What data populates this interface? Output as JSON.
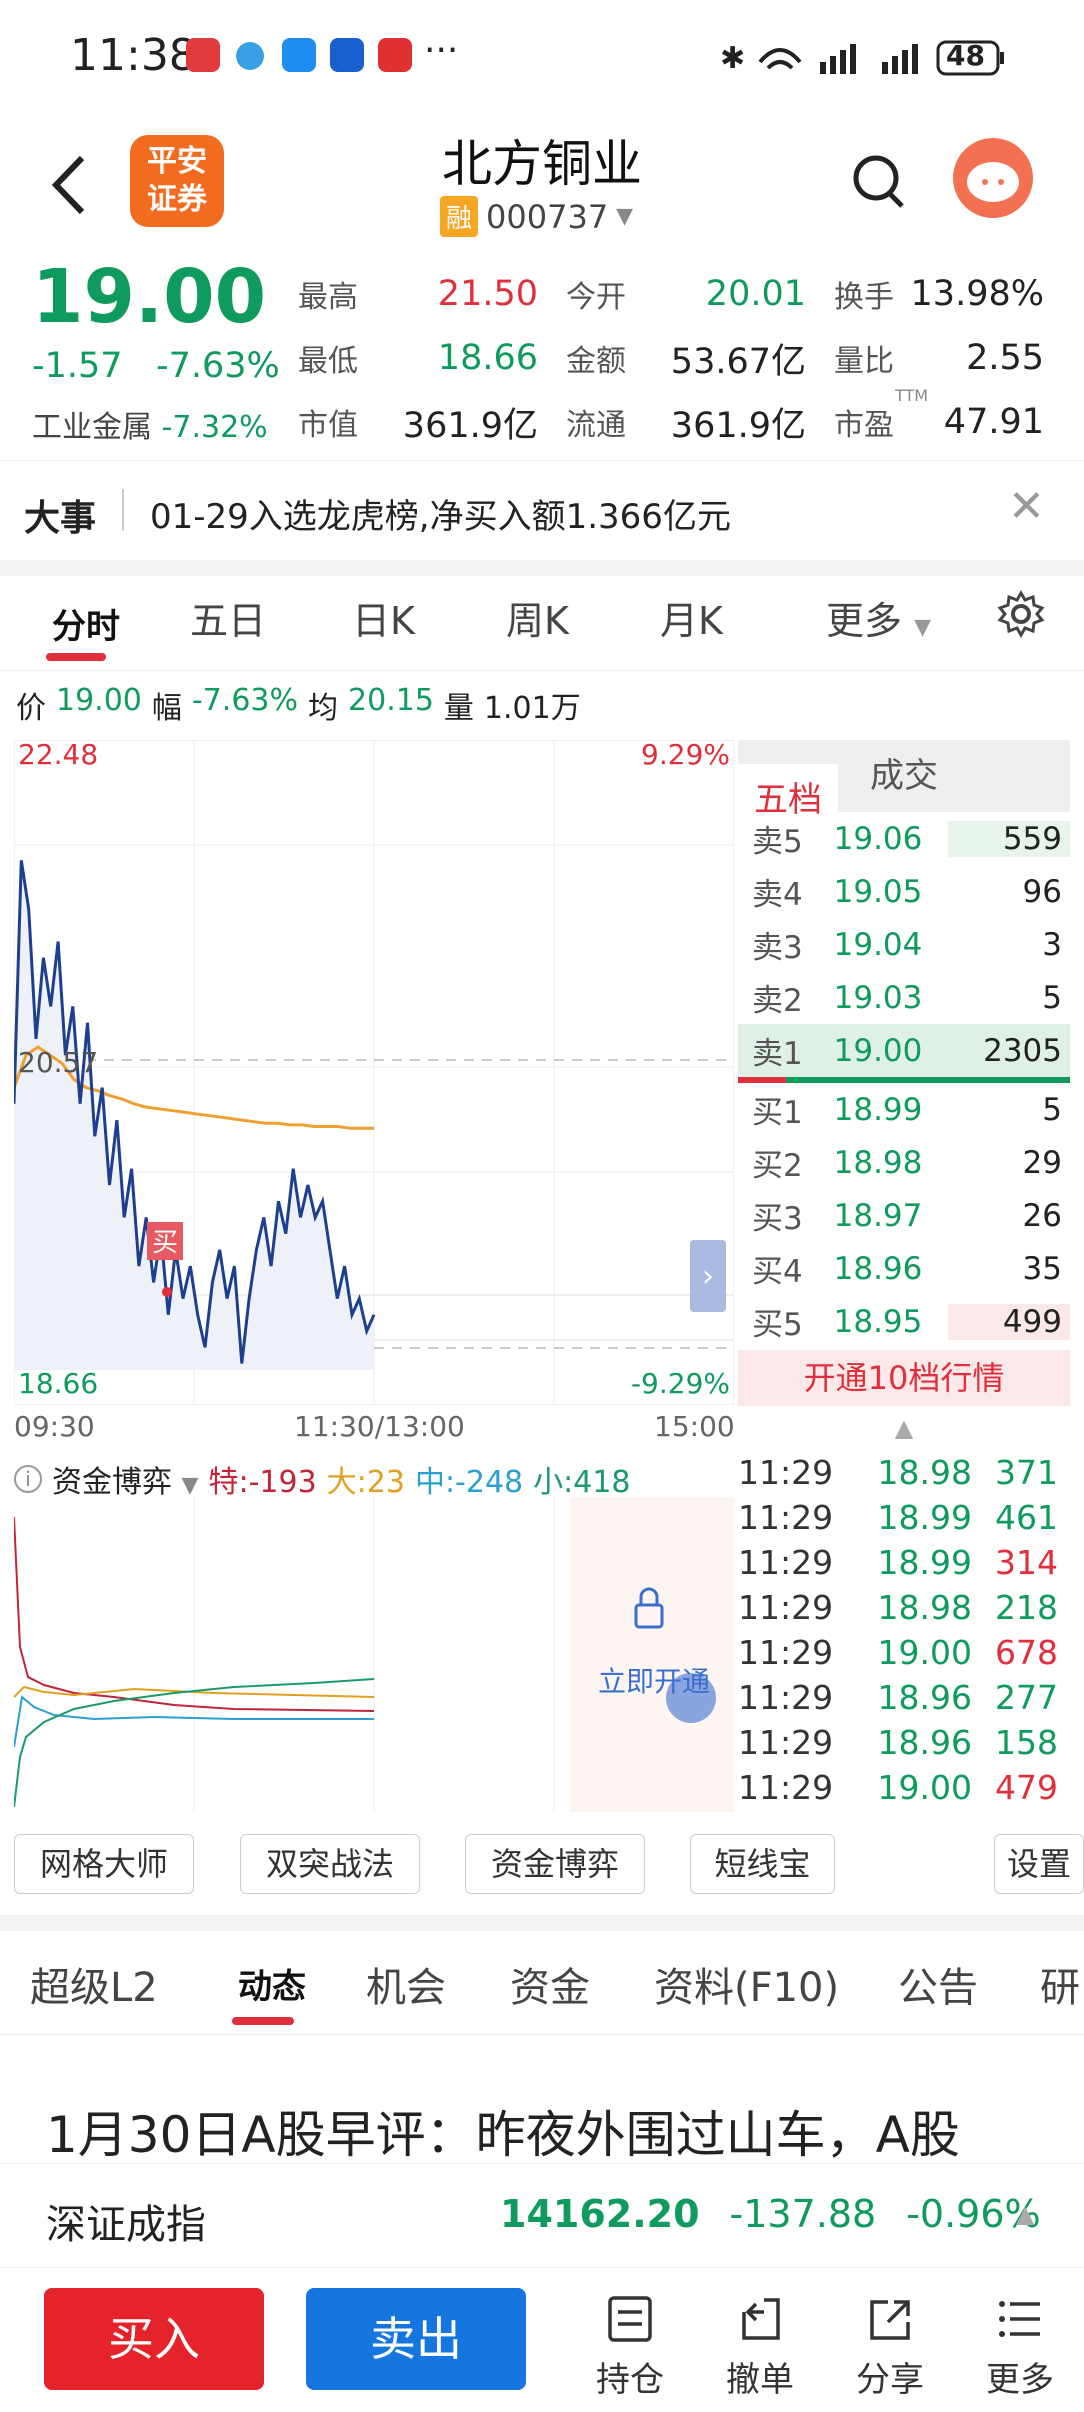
{
  "status": {
    "time": "11:38",
    "battery": "48"
  },
  "header": {
    "logo_line1": "平安",
    "logo_line2": "证券",
    "title": "北方铜业",
    "rong": "融",
    "code": "000737"
  },
  "quote": {
    "price": "19.00",
    "change": "-1.57",
    "change_pct": "-7.63%",
    "industry": "工业金属",
    "industry_pct": "-7.32%",
    "rows": [
      [
        {
          "l": "最高",
          "v": "21.50",
          "c": "red"
        },
        {
          "l": "今开",
          "v": "20.01",
          "c": "green"
        },
        {
          "l": "换手",
          "v": "13.98%",
          "c": ""
        }
      ],
      [
        {
          "l": "最低",
          "v": "18.66",
          "c": "green"
        },
        {
          "l": "金额",
          "v": "53.67亿",
          "c": ""
        },
        {
          "l": "量比",
          "v": "2.55",
          "c": ""
        }
      ],
      [
        {
          "l": "市值",
          "v": "361.9亿",
          "c": ""
        },
        {
          "l": "流通",
          "v": "361.9亿",
          "c": ""
        },
        {
          "l": "市盈",
          "v": "47.91",
          "c": ""
        }
      ]
    ],
    "ttm": "TTM"
  },
  "news": {
    "tag": "大事",
    "text": "01-29入选龙虎榜,净买入额1.366亿元"
  },
  "ktabs": [
    "分时",
    "五日",
    "日K",
    "周K",
    "月K",
    "更多"
  ],
  "info": {
    "price_l": "价",
    "price": "19.00",
    "amp_l": "幅",
    "amp": "-7.63%",
    "avg_l": "均",
    "avg": "20.15",
    "vol_l": "量",
    "vol": "1.01万"
  },
  "chart": {
    "top_left": "22.48",
    "top_right": "9.29%",
    "mid": "20.57",
    "bottom_left": "18.66",
    "bottom_right": "-9.29%",
    "t_start": "09:30",
    "t_mid": "11:30/13:00",
    "t_end": "15:00",
    "buy_mark": "买"
  },
  "chart_data": {
    "type": "line",
    "ylim": [
      18.66,
      22.48
    ],
    "prev_close": 20.57,
    "series": [],
    "price": [
      20.3,
      21.8,
      21.5,
      20.7,
      21.2,
      20.9,
      21.3,
      20.6,
      20.9,
      20.3,
      20.8,
      20.1,
      20.4,
      19.8,
      20.2,
      19.6,
      19.9,
      19.3,
      19.6,
      19.2,
      19.5,
      19.0,
      19.4,
      19.1,
      19.3,
      19.0,
      18.8,
      19.2,
      19.4,
      19.1,
      19.3,
      18.7,
      19.1,
      19.4,
      19.6,
      19.3,
      19.7,
      19.5,
      19.9,
      19.6,
      19.8,
      19.6,
      19.7,
      19.4,
      19.1,
      19.3,
      19.0,
      19.1,
      18.9,
      19.0
    ],
    "avg": [
      20.4,
      20.6,
      20.65,
      20.6,
      20.55,
      20.45,
      20.4,
      20.38,
      20.35,
      20.33,
      20.3,
      20.28,
      20.27,
      20.26,
      20.25,
      20.24,
      20.23,
      20.22,
      20.21,
      20.2,
      20.19,
      20.18,
      20.18,
      20.17,
      20.17,
      20.16,
      20.16,
      20.16,
      20.15,
      20.15,
      20.15
    ]
  },
  "book": {
    "tab1": "五档",
    "tab2": "成交",
    "asks": [
      {
        "l": "卖5",
        "p": "19.06",
        "v": "559"
      },
      {
        "l": "卖4",
        "p": "19.05",
        "v": "96"
      },
      {
        "l": "卖3",
        "p": "19.04",
        "v": "3"
      },
      {
        "l": "卖2",
        "p": "19.03",
        "v": "5"
      },
      {
        "l": "卖1",
        "p": "19.00",
        "v": "2305"
      }
    ],
    "bids": [
      {
        "l": "买1",
        "p": "18.99",
        "v": "5"
      },
      {
        "l": "买2",
        "p": "18.98",
        "v": "29"
      },
      {
        "l": "买3",
        "p": "18.97",
        "v": "26"
      },
      {
        "l": "买4",
        "p": "18.96",
        "v": "35"
      },
      {
        "l": "买5",
        "p": "18.95",
        "v": "499"
      }
    ],
    "open10": "开通10档行情",
    "trades": [
      {
        "t": "11:29",
        "p": "18.98",
        "v": "371",
        "c": "green"
      },
      {
        "t": "11:29",
        "p": "18.99",
        "v": "461",
        "c": "green"
      },
      {
        "t": "11:29",
        "p": "18.99",
        "v": "314",
        "c": "red"
      },
      {
        "t": "11:29",
        "p": "18.98",
        "v": "218",
        "c": "green"
      },
      {
        "t": "11:29",
        "p": "19.00",
        "v": "678",
        "c": "red"
      },
      {
        "t": "11:29",
        "p": "18.96",
        "v": "277",
        "c": "green"
      },
      {
        "t": "11:29",
        "p": "18.96",
        "v": "158",
        "c": "green"
      },
      {
        "t": "11:29",
        "p": "19.00",
        "v": "479",
        "c": "red"
      }
    ]
  },
  "fund": {
    "name": "资金博弈",
    "te": "特:-193",
    "da": "大:23",
    "zhong": "中:-248",
    "xiao": "小:418",
    "unlock": "立即开通"
  },
  "tools": [
    "网格大师",
    "双突战法",
    "资金博弈",
    "短线宝",
    "设置"
  ],
  "btabs": [
    "超级L2",
    "动态",
    "机会",
    "资金",
    "资料(F10)",
    "公告",
    "研"
  ],
  "headline": "1月30日A股早评：昨夜外围过山车，A股",
  "index": {
    "name": "深证成指",
    "value": "14162.20",
    "chg": "-137.88",
    "pct": "-0.96%"
  },
  "actions": {
    "buy": "买入",
    "sell": "卖出",
    "hold": "持仓",
    "cancel": "撤单",
    "share": "分享",
    "more": "更多"
  }
}
